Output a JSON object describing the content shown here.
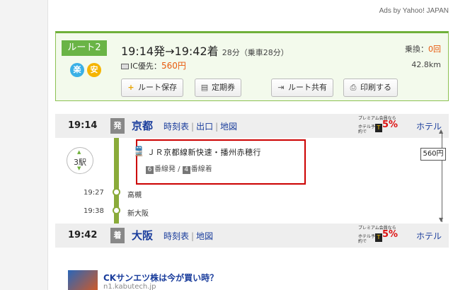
{
  "ads_label": "Ads by Yahoo! JAPAN",
  "route": {
    "badge": "ルート2",
    "icon_raku": "楽",
    "icon_an": "安",
    "times": "19:14発→19:42着",
    "duration": "28分（乗車28分）",
    "ic_label": "IC優先：",
    "ic_fare": "560円",
    "transfer_label": "乗換：",
    "transfer_count": "0回",
    "distance": "42.8km",
    "buttons": {
      "save": "ルート保存",
      "pass": "定期券",
      "share": "ルート共有",
      "print": "印刷する"
    }
  },
  "departure": {
    "time": "19:14",
    "kind": "発",
    "station": "京都",
    "link_timetable": "時刻表",
    "link_exit": "出口",
    "link_map": "地図",
    "hotel": "ホテル"
  },
  "premium": {
    "line1": "プレミアム会員なら",
    "line2": "ホテル予約で",
    "mark": "T",
    "percent": "5%"
  },
  "segment": {
    "stops": "3駅",
    "train": "ＪＲ京都線新快速・播州赤穂行",
    "dep_platform_num": "6",
    "dep_platform_text": "番線発",
    "arr_platform_num": "4",
    "arr_platform_text": "番線着",
    "fare": "560円",
    "intermediate": [
      {
        "time": "19:27",
        "name": "高槻"
      },
      {
        "time": "19:38",
        "name": "新大阪"
      }
    ]
  },
  "arrival": {
    "time": "19:42",
    "kind": "着",
    "station": "大阪",
    "link_timetable": "時刻表",
    "link_map": "地図",
    "hotel": "ホテル"
  },
  "ad": {
    "title": "CKサンエツ株は今が買い時？",
    "url": "n1.kabutech.jp"
  },
  "icons": [
    "plus-icon",
    "map-pass-icon",
    "share-icon",
    "print-icon",
    "train-icon",
    "ic-card-icon"
  ],
  "colors": {
    "accent_green": "#6ab446",
    "link_blue": "#1a3d9c",
    "fare_orange": "#e8590c",
    "highlight_red": "#cc0000"
  }
}
